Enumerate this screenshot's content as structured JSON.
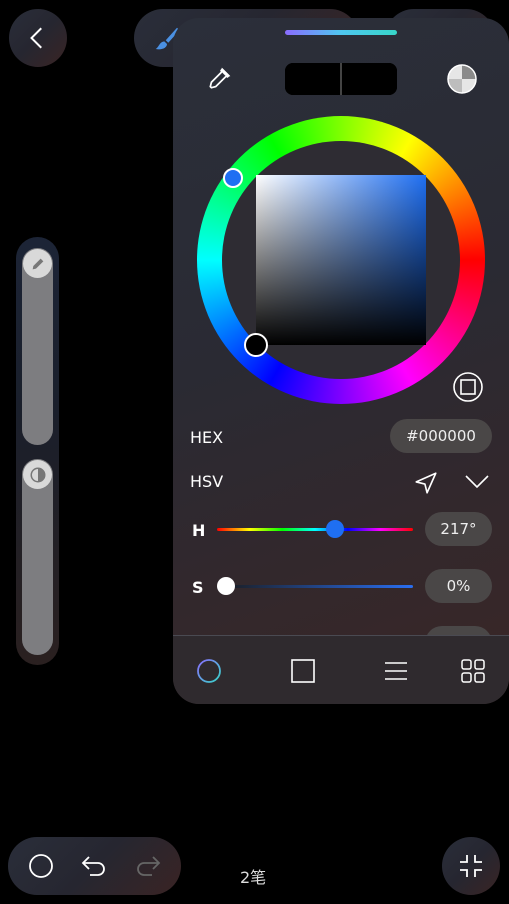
{
  "panel": {
    "hex_label": "HEX",
    "hex_value": "#000000",
    "mode_label": "HSV",
    "h_label": "H",
    "h_value": "217°",
    "h_fraction": 0.6,
    "s_label": "S",
    "s_value": "0%",
    "s_fraction": 0.0,
    "current_color": "#000000",
    "previous_color": "#000000",
    "hue_color": "#1f6ff2"
  },
  "bottom": {
    "stroke_count": "2笔"
  },
  "icons": {
    "back": "chevron-left-icon",
    "brush": "brush-icon",
    "eyedropper": "eyedropper-icon",
    "palette_mode": "color-circle-icon",
    "square_mode": "square-in-circle-icon",
    "send": "send-icon",
    "expand": "chevron-down-icon",
    "tabs": [
      "ring-icon",
      "square-icon",
      "list-icon",
      "grid-icon"
    ],
    "undo": "undo-icon",
    "redo": "redo-icon",
    "fullscreen": "collapse-icon"
  },
  "sliders": {
    "size_fraction": 1.0,
    "opacity_fraction": 1.0
  }
}
